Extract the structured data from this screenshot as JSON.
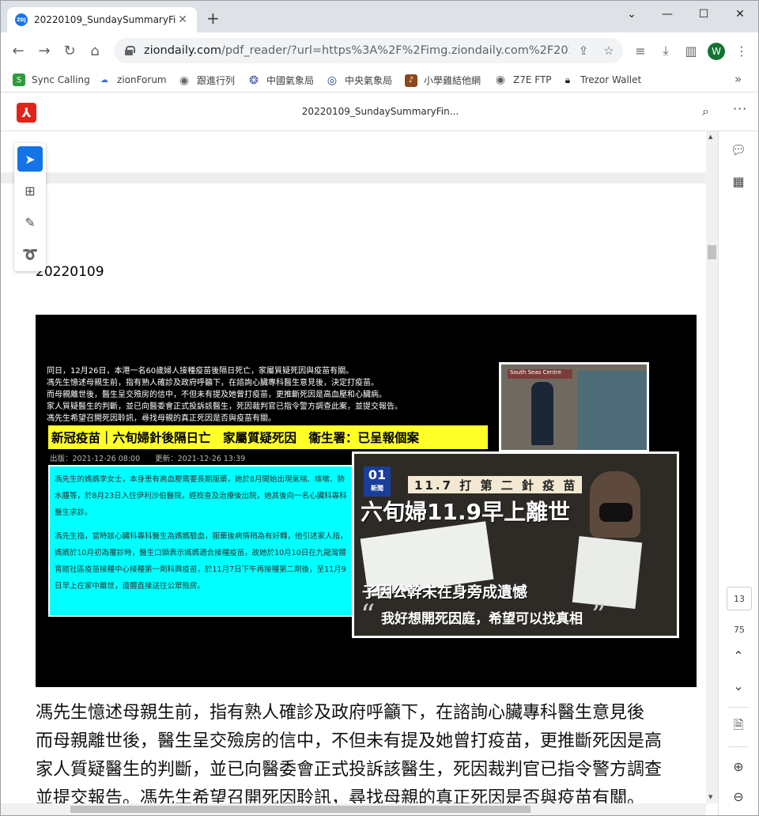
{
  "browser": {
    "tab": {
      "title": "20220109_SundaySummaryFin",
      "favicon_text": "ZDJ",
      "close_icon": "close-icon"
    },
    "window_controls": [
      "minimize-icon",
      "maximize-icon",
      "close-icon"
    ],
    "omnibox": {
      "host": "ziondaily.com",
      "path": "/pdf_reader/?url=https%3A%2F%2Fimg.ziondaily.com%2F2022%2..."
    },
    "profile_initial": "W",
    "bookmarks": [
      {
        "label": "Sync Calling",
        "icon": "sync-calling-icon",
        "color": "#2e9b3e"
      },
      {
        "label": "zionForum",
        "icon": "zionforum-icon",
        "color": "#3a6fd8"
      },
      {
        "label": "跟進行列",
        "icon": "globe-icon",
        "color": "#5f6368"
      },
      {
        "label": "中國氣象局",
        "icon": "cma-icon",
        "color": "#3a5aa8"
      },
      {
        "label": "中央氣象局",
        "icon": "cwb-icon",
        "color": "#1b3f8a"
      },
      {
        "label": "小學雞結他網",
        "icon": "guitar-site-icon",
        "color": "#8a4a1b"
      },
      {
        "label": "Z7E FTP",
        "icon": "globe-icon",
        "color": "#5f6368"
      },
      {
        "label": "Trezor Wallet",
        "icon": "trezor-icon",
        "color": "#202124"
      }
    ]
  },
  "pdf": {
    "title": "20220109_SundaySummaryFin...",
    "date": "20220109",
    "page_current": "13",
    "page_total": "75"
  },
  "image": {
    "topline": [
      "同日，12月26日，本港一名60歲婦人接種疫苗後隔日死亡，家屬質疑死因與疫苗有關。",
      "馮先生憶述母親生前，指有熟人確診及政府呼籲下，在諮詢心臟專科醫生意見後，決定打疫苗。",
      "而母親離世後，醫生呈交殮房的信中，不但未有提及她曾打疫苗，更推斷死因是高血壓和心臟病。",
      "家人質疑醫生的判斷，並已向醫委會正式投訴該醫生，死因裁判官已指令警方調查此案，並提交報告。",
      "馮先生希望召開死因聆訊，尋找母親的真正死因是否與疫苗有關。"
    ],
    "yellow_headline": "新冠疫苗｜六旬婦針後隔日亡　家屬質疑死因　衞生署：已呈報個案",
    "meta": "出版：2021-12-26 08:00　　更新：2021-12-26 13:39",
    "cyan_paragraphs": [
      "馮先生的媽媽李女士，本身患有高血壓需要長期服藥，她於8月開始出現氣喘、咳嗽、肺水腫等，於8月23日入住伊利沙伯醫院，經檢查及治療後出院，她其後向一名心臟科專科醫生求診。",
      "馮先生指，當時該心臟科專科醫生為媽媽驗血，服藥後病情稍為有好轉，他引述家人指，媽媽於10月初為覆診時，醫生口頭表示媽媽適合接種疫苗，故她於10月10日在九龍灣體育館社區疫苗接種中心接種第一劑科興疫苗，於11月7日下午再接種第二劑後，至11月9日早上在家中離世，遺體直接送往公眾殮房。"
    ],
    "street_sign": "South Seas Centre",
    "news_logo": "01",
    "news_logo_sub": "新聞",
    "news_sub": "11.7 打 第 二 針 疫 苗",
    "news_headline": "六旬婦11.9早上離世",
    "caption1": "子因公幹未在身旁成遺憾",
    "caption2": "我好想開死因庭，希望可以找真相"
  },
  "article": {
    "lines": [
      "馮先生憶述母親生前，指有熟人確診及政府呼籲下，在諮詢心臟專科醫生意見後",
      "而母親離世後，醫生呈交殮房的信中，不但未有提及她曾打疫苗，更推斷死因是高",
      "家人質疑醫生的判斷，並已向醫委會正式投訴該醫生，死因裁判官已指令警方調查",
      "並提交報告。馮先生希望召開死因聆訊，尋找母親的真正死因是否與疫苗有關。"
    ]
  },
  "colors": {
    "accent": "#1473e6",
    "acrobat_red": "#e2231a",
    "headline_yellow": "#ffff2a",
    "panel_cyan": "#00ffff"
  }
}
